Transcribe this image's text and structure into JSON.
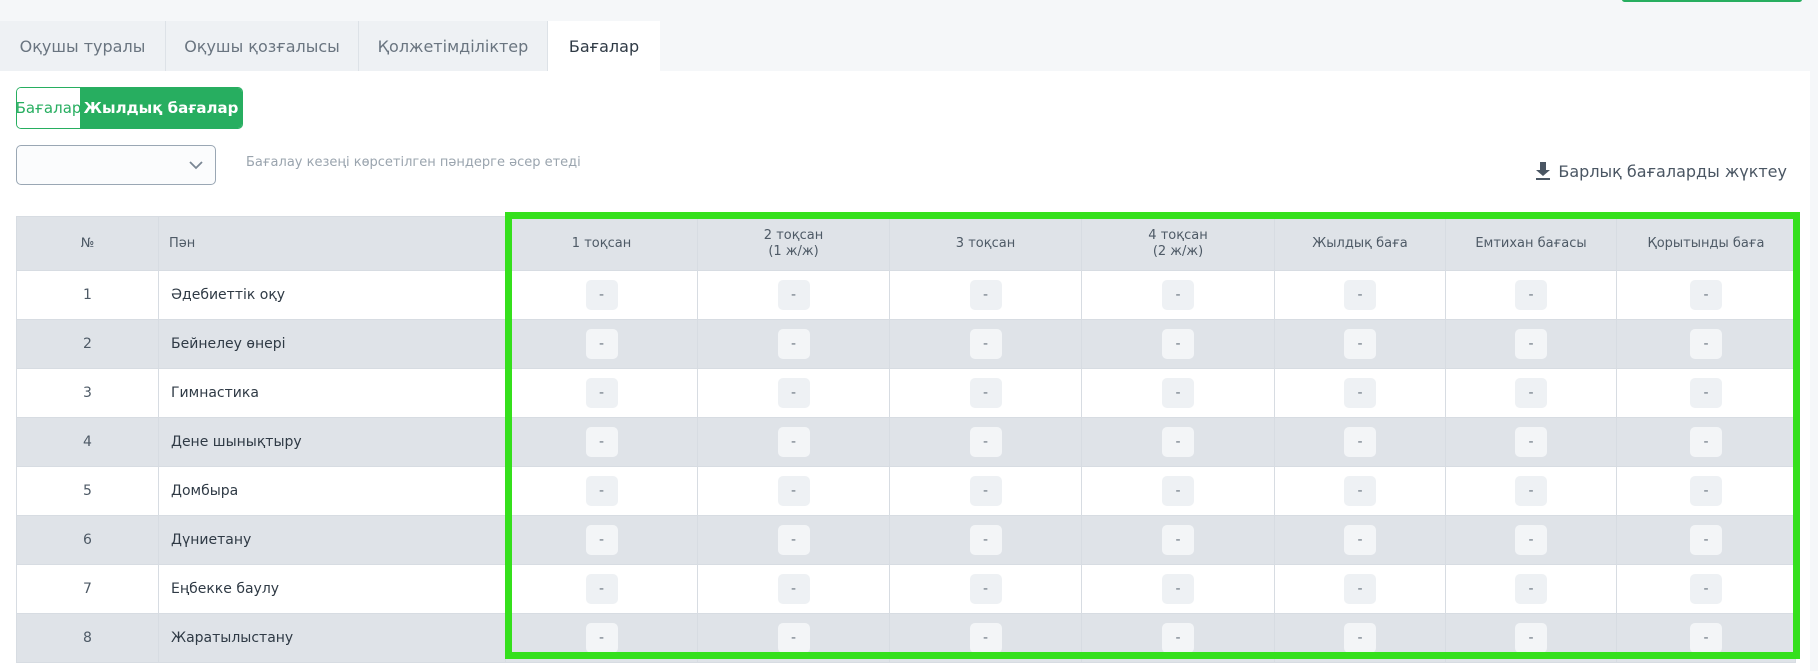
{
  "tabs": [
    {
      "label": "Оқушы туралы"
    },
    {
      "label": "Оқушы қозғалысы"
    },
    {
      "label": "Қолжетімділіктер"
    },
    {
      "label": "Бағалар"
    }
  ],
  "toggle": {
    "left": "Бағалар",
    "right": "Жылдық бағалар"
  },
  "period_select": {
    "value": ""
  },
  "hint": "Бағалау кезеңі көрсетілген пәндерге әсер етеді",
  "download_all": "Барлық бағаларды жүктеу",
  "table": {
    "headers": {
      "num": "№",
      "subject": "Пән",
      "q1": "1 тоқсан",
      "q2_line1": "2 тоқсан",
      "q2_line2": "(1 ж/ж)",
      "q3": "3 тоқсан",
      "q4_line1": "4 тоқсан",
      "q4_line2": "(2 ж/ж)",
      "annual": "Жылдық баға",
      "exam": "Емтихан бағасы",
      "final": "Қорытынды баға"
    },
    "rows": [
      {
        "num": "1",
        "subject": "Әдебиеттік оқу",
        "g": [
          "-",
          "-",
          "-",
          "-",
          "-",
          "-",
          "-"
        ]
      },
      {
        "num": "2",
        "subject": "Бейнелеу өнері",
        "g": [
          "-",
          "-",
          "-",
          "-",
          "-",
          "-",
          "-"
        ]
      },
      {
        "num": "3",
        "subject": "Гимнастика",
        "g": [
          "-",
          "-",
          "-",
          "-",
          "-",
          "-",
          "-"
        ]
      },
      {
        "num": "4",
        "subject": "Дене шынықтыру",
        "g": [
          "-",
          "-",
          "-",
          "-",
          "-",
          "-",
          "-"
        ]
      },
      {
        "num": "5",
        "subject": "Домбыра",
        "g": [
          "-",
          "-",
          "-",
          "-",
          "-",
          "-",
          "-"
        ]
      },
      {
        "num": "6",
        "subject": "Дүниетану",
        "g": [
          "-",
          "-",
          "-",
          "-",
          "-",
          "-",
          "-"
        ]
      },
      {
        "num": "7",
        "subject": "Еңбекке баулу",
        "g": [
          "-",
          "-",
          "-",
          "-",
          "-",
          "-",
          "-"
        ]
      },
      {
        "num": "8",
        "subject": "Жаратылыстану",
        "g": [
          "-",
          "-",
          "-",
          "-",
          "-",
          "-",
          "-"
        ]
      }
    ]
  },
  "colors": {
    "accent": "#27ae60",
    "highlight": "#35e01c",
    "row_alt": "#dfe3e8"
  }
}
